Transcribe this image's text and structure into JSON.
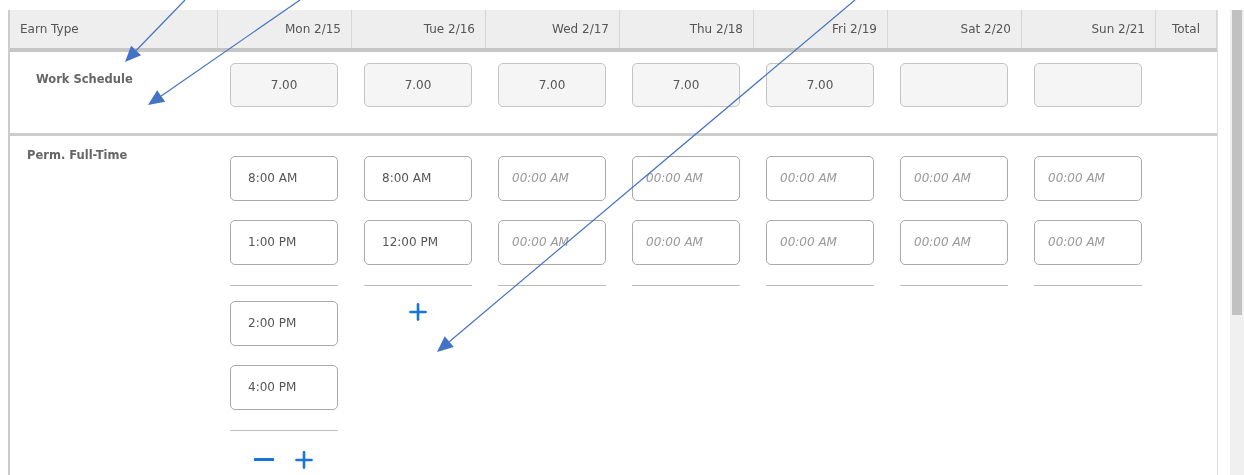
{
  "columns": [
    {
      "label": "Earn Type"
    },
    {
      "label": "Mon 2/15"
    },
    {
      "label": "Tue 2/16"
    },
    {
      "label": "Wed 2/17"
    },
    {
      "label": "Thu 2/18"
    },
    {
      "label": "Fri 2/19"
    },
    {
      "label": "Sat 2/20"
    },
    {
      "label": "Sun 2/21"
    },
    {
      "label": "Total"
    }
  ],
  "schedule": {
    "label": "Work Schedule",
    "cells": [
      {
        "kind": "hours",
        "value": "7.00"
      },
      {
        "kind": "hours",
        "value": "7.00"
      },
      {
        "kind": "hours",
        "value": "7.00"
      },
      {
        "kind": "hours",
        "value": "7.00"
      },
      {
        "kind": "hours",
        "value": "7.00"
      },
      {
        "kind": "blank"
      },
      {
        "kind": "blank"
      }
    ]
  },
  "earn_row": {
    "label": "Perm. Full-Time",
    "days": [
      {
        "pairs": [
          [
            {
              "value": "8:00 AM"
            },
            {
              "value": "1:00 PM"
            }
          ],
          [
            {
              "value": "2:00 PM"
            },
            {
              "value": "4:00 PM"
            }
          ]
        ],
        "can_remove": true,
        "can_add": true
      },
      {
        "pairs": [
          [
            {
              "value": "8:00 AM"
            },
            {
              "value": "12:00 PM"
            }
          ]
        ],
        "can_remove": false,
        "can_add": true
      },
      {
        "pairs": [
          [
            {
              "placeholder": "00:00 AM"
            },
            {
              "placeholder": "00:00 AM"
            }
          ]
        ],
        "can_remove": false,
        "can_add": false
      },
      {
        "pairs": [
          [
            {
              "placeholder": "00:00 AM"
            },
            {
              "placeholder": "00:00 AM"
            }
          ]
        ],
        "can_remove": false,
        "can_add": false
      },
      {
        "pairs": [
          [
            {
              "placeholder": "00:00 AM"
            },
            {
              "placeholder": "00:00 AM"
            }
          ]
        ],
        "can_remove": false,
        "can_add": false
      },
      {
        "pairs": [
          [
            {
              "placeholder": "00:00 AM"
            },
            {
              "placeholder": "00:00 AM"
            }
          ]
        ],
        "can_remove": false,
        "can_add": false
      },
      {
        "pairs": [
          [
            {
              "placeholder": "00:00 AM"
            },
            {
              "placeholder": "00:00 AM"
            }
          ]
        ],
        "can_remove": false,
        "can_add": false
      }
    ]
  },
  "annotation_arrows": [
    {
      "kind": "arrow"
    },
    {
      "kind": "arrow"
    },
    {
      "kind": "arrow"
    }
  ]
}
